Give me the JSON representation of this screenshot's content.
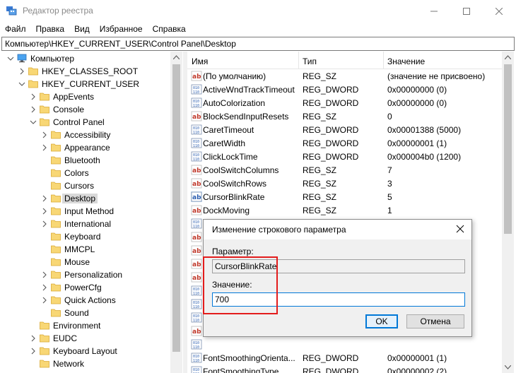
{
  "window": {
    "title": "Редактор реестра",
    "icon": "regedit-icon"
  },
  "menu": [
    "Файл",
    "Правка",
    "Вид",
    "Избранное",
    "Справка"
  ],
  "address": "Компьютер\\HKEY_CURRENT_USER\\Control Panel\\Desktop",
  "tree": [
    {
      "label": "Компьютер",
      "arrow": "expanded",
      "icon": "computer-icon"
    },
    {
      "label": "HKEY_CLASSES_ROOT",
      "arrow": "collapsed",
      "icon": "folder-icon"
    },
    {
      "label": "HKEY_CURRENT_USER",
      "arrow": "expanded",
      "icon": "folder-icon"
    },
    {
      "label": "AppEvents",
      "arrow": "collapsed",
      "icon": "folder-icon"
    },
    {
      "label": "Console",
      "arrow": "collapsed",
      "icon": "folder-icon"
    },
    {
      "label": "Control Panel",
      "arrow": "expanded",
      "icon": "folder-icon"
    },
    {
      "label": "Accessibility",
      "arrow": "collapsed",
      "icon": "folder-icon"
    },
    {
      "label": "Appearance",
      "arrow": "collapsed",
      "icon": "folder-icon"
    },
    {
      "label": "Bluetooth",
      "arrow": "none",
      "icon": "folder-icon"
    },
    {
      "label": "Colors",
      "arrow": "none",
      "icon": "folder-icon"
    },
    {
      "label": "Cursors",
      "arrow": "none",
      "icon": "folder-icon"
    },
    {
      "label": "Desktop",
      "arrow": "collapsed",
      "icon": "folder-icon",
      "selected": true
    },
    {
      "label": "Input Method",
      "arrow": "collapsed",
      "icon": "folder-icon"
    },
    {
      "label": "International",
      "arrow": "collapsed",
      "icon": "folder-icon"
    },
    {
      "label": "Keyboard",
      "arrow": "none",
      "icon": "folder-icon"
    },
    {
      "label": "MMCPL",
      "arrow": "none",
      "icon": "folder-icon"
    },
    {
      "label": "Mouse",
      "arrow": "none",
      "icon": "folder-icon"
    },
    {
      "label": "Personalization",
      "arrow": "collapsed",
      "icon": "folder-icon"
    },
    {
      "label": "PowerCfg",
      "arrow": "collapsed",
      "icon": "folder-icon"
    },
    {
      "label": "Quick Actions",
      "arrow": "collapsed",
      "icon": "folder-icon"
    },
    {
      "label": "Sound",
      "arrow": "none",
      "icon": "folder-icon"
    },
    {
      "label": "Environment",
      "arrow": "none",
      "icon": "folder-icon"
    },
    {
      "label": "EUDC",
      "arrow": "collapsed",
      "icon": "folder-icon"
    },
    {
      "label": "Keyboard Layout",
      "arrow": "collapsed",
      "icon": "folder-icon"
    },
    {
      "label": "Network",
      "arrow": "none",
      "icon": "folder-icon"
    }
  ],
  "columns": {
    "name": "Имя",
    "type": "Тип",
    "value": "Значение"
  },
  "rows": [
    {
      "name": "(По умолчанию)",
      "type": "REG_SZ",
      "value": "(значение не присвоено)",
      "icon": "string-value-icon"
    },
    {
      "name": "ActiveWndTrackTimeout",
      "type": "REG_DWORD",
      "value": "0x00000000 (0)",
      "icon": "binary-value-icon"
    },
    {
      "name": "AutoColorization",
      "type": "REG_DWORD",
      "value": "0x00000000 (0)",
      "icon": "binary-value-icon"
    },
    {
      "name": "BlockSendInputResets",
      "type": "REG_SZ",
      "value": "0",
      "icon": "string-value-icon"
    },
    {
      "name": "CaretTimeout",
      "type": "REG_DWORD",
      "value": "0x00001388 (5000)",
      "icon": "binary-value-icon"
    },
    {
      "name": "CaretWidth",
      "type": "REG_DWORD",
      "value": "0x00000001 (1)",
      "icon": "binary-value-icon"
    },
    {
      "name": "ClickLockTime",
      "type": "REG_DWORD",
      "value": "0x000004b0 (1200)",
      "icon": "binary-value-icon"
    },
    {
      "name": "CoolSwitchColumns",
      "type": "REG_SZ",
      "value": "7",
      "icon": "string-value-icon"
    },
    {
      "name": "CoolSwitchRows",
      "type": "REG_SZ",
      "value": "3",
      "icon": "string-value-icon"
    },
    {
      "name": "CursorBlinkRate",
      "type": "REG_SZ",
      "value": "5",
      "icon": "string-value-selected-icon"
    },
    {
      "name": "DockMoving",
      "type": "REG_SZ",
      "value": "1",
      "icon": "string-value-icon"
    },
    {
      "name": "",
      "type": "",
      "value": "",
      "icon": "binary-value-icon"
    },
    {
      "name": "",
      "type": "",
      "value": "",
      "icon": "string-value-icon"
    },
    {
      "name": "",
      "type": "",
      "value": "",
      "icon": "string-value-icon"
    },
    {
      "name": "",
      "type": "",
      "value": "",
      "icon": "string-value-icon"
    },
    {
      "name": "",
      "type": "",
      "value": "",
      "icon": "string-value-icon"
    },
    {
      "name": "",
      "type": "",
      "value": "",
      "icon": "binary-value-icon"
    },
    {
      "name": "",
      "type": "",
      "value": "",
      "icon": "binary-value-icon"
    },
    {
      "name": "",
      "type": "",
      "value": "",
      "icon": "binary-value-icon"
    },
    {
      "name": "",
      "type": "",
      "value": "",
      "icon": "string-value-icon"
    },
    {
      "name": "",
      "type": "",
      "value": "",
      "icon": "binary-value-icon"
    },
    {
      "name": "FontSmoothingOrienta...",
      "type": "REG_DWORD",
      "value": "0x00000001 (1)",
      "icon": "binary-value-icon"
    },
    {
      "name": "FontSmoothingType",
      "type": "REG_DWORD",
      "value": "0x00000002 (2)",
      "icon": "binary-value-icon"
    }
  ],
  "dialog": {
    "title": "Изменение строкового параметра",
    "param_label": "Параметр:",
    "param_value": "CursorBlinkRate",
    "value_label": "Значение:",
    "value": "700",
    "ok": "OK",
    "cancel": "Отмена"
  },
  "colors": {
    "selection": "#d9d9d9",
    "accent": "#0078d7",
    "highlight": "#e31c1c"
  }
}
